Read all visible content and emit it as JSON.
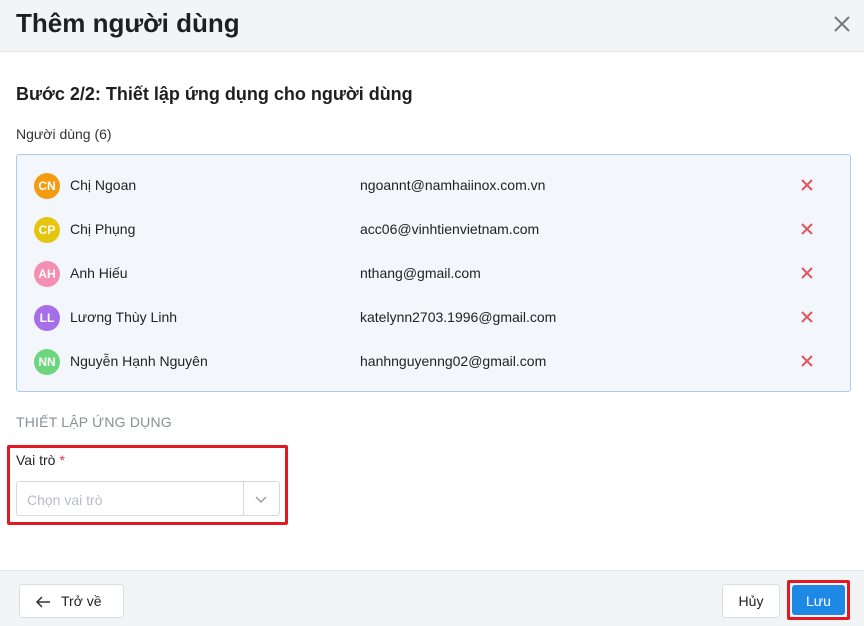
{
  "header": {
    "title": "Thêm người dùng",
    "close_icon": "close-icon"
  },
  "step": {
    "title": "Bước 2/2: Thiết lập ứng dụng cho người dùng"
  },
  "users": {
    "label": "Người dùng (6)",
    "items": [
      {
        "initials": "CN",
        "name": "Chị Ngoan",
        "email": "ngoannt@namhaiinox.com.vn",
        "color": "#f39c12"
      },
      {
        "initials": "CP",
        "name": "Chị Phụng",
        "email": "acc06@vinhtienvietnam.com",
        "color": "#e6c50f"
      },
      {
        "initials": "AH",
        "name": "Anh Hiếu",
        "email": "nthang@gmail.com",
        "color": "#f48fb1"
      },
      {
        "initials": "LL",
        "name": "Lương Thùy Linh",
        "email": "katelynn2703.1996@gmail.com",
        "color": "#a66ee8"
      },
      {
        "initials": "NN",
        "name": "Nguyễn Hạnh Nguyên",
        "email": "hanhnguyenng02@gmail.com",
        "color": "#6cd67c"
      }
    ]
  },
  "app_settings": {
    "section_title": "THIẾT LẬP ỨNG DỤNG",
    "role": {
      "label": "Vai trò",
      "required_mark": "*",
      "placeholder": "Chọn vai trò"
    }
  },
  "footer": {
    "back_label": "Trở về",
    "cancel_label": "Hủy",
    "save_label": "Lưu"
  },
  "colors": {
    "accent": "#1e88e5",
    "highlight": "#e01922",
    "remove": "#e5565f"
  }
}
